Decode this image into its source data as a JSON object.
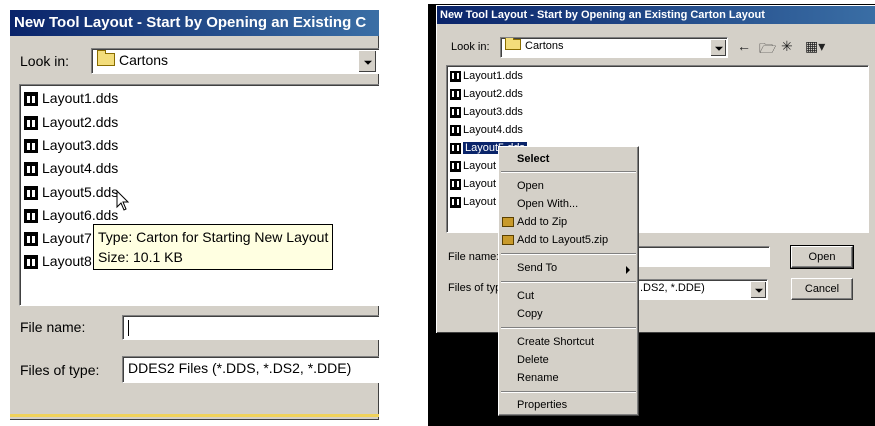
{
  "left_zoom": {
    "title": "New Tool Layout - Start by Opening an Existing C",
    "look_in_label": "Look in:",
    "look_in_value": "Cartons",
    "files": [
      "Layout1.dds",
      "Layout2.dds",
      "Layout3.dds",
      "Layout4.dds",
      "Layout5.dds",
      "Layout6.dds",
      "Layout7",
      "Layout8"
    ],
    "tooltip_type": "Type: Carton for Starting New Layout",
    "tooltip_size": "Size: 10.1 KB",
    "file_name_label": "File name:",
    "file_name_value": "",
    "files_of_type_label": "Files of type:",
    "files_of_type_value": "DDES2 Files (*.DDS, *.DS2, *.DDE)"
  },
  "right_dialog": {
    "title": "New Tool Layout - Start by Opening an Existing Carton Layout",
    "look_in_label": "Look in:",
    "look_in_value": "Cartons",
    "toolbar_icons": [
      "back-arrow-icon",
      "up-folder-icon",
      "new-folder-icon",
      "view-menu-icon"
    ],
    "files": [
      "Layout1.dds",
      "Layout2.dds",
      "Layout3.dds",
      "Layout4.dds",
      "Layout5.dds",
      "Layout6.dds",
      "Layout7.dds",
      "Layout8.dds"
    ],
    "selected_file": "Layout5.dds",
    "visible_file_labels": [
      "Layout1.dds",
      "Layout2.dds",
      "Layout3.dds",
      "Layout4.dds",
      "Layout5.dds",
      "Layout",
      "Layout",
      "Layout"
    ],
    "file_name_label": "File name:",
    "files_of_type_label": "Files of typ",
    "files_of_type_value": ".DS2, *.DDE)",
    "open_button": "Open",
    "cancel_button": "Cancel"
  },
  "context_menu": {
    "select": "Select",
    "open": "Open",
    "open_with": "Open With...",
    "add_to_zip": "Add to Zip",
    "add_to_named_zip": "Add to Layout5.zip",
    "send_to": "Send To",
    "cut": "Cut",
    "copy": "Copy",
    "create_shortcut": "Create Shortcut",
    "delete": "Delete",
    "rename": "Rename",
    "properties": "Properties"
  },
  "colors": {
    "title_start": "#0a246a",
    "title_end": "#3a6ea5",
    "face": "#d4d0c8",
    "selection": "#0a246a",
    "tooltip_bg": "#ffffe1",
    "desktop_black": "#000000"
  }
}
